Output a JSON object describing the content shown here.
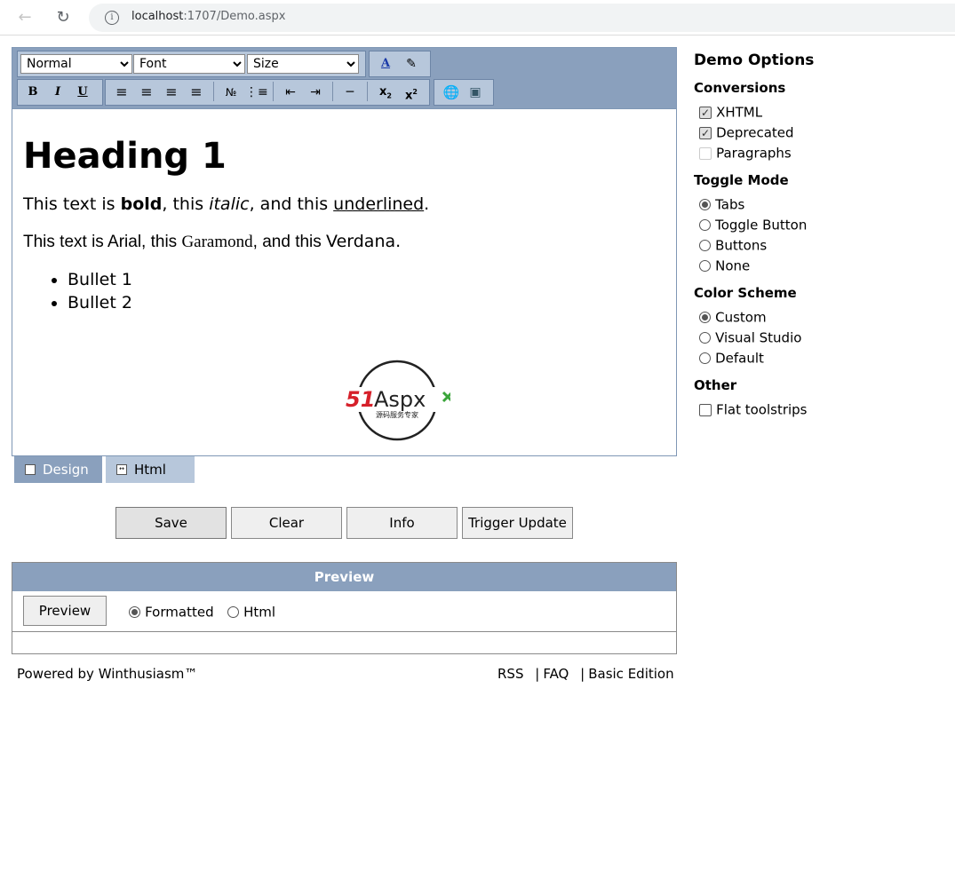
{
  "browser": {
    "url_host": "localhost",
    "url_rest": ":1707/Demo.aspx"
  },
  "toolbar": {
    "paragraph_select": "Normal",
    "font_select": "Font",
    "size_select": "Size"
  },
  "editor_content": {
    "heading": "Heading 1",
    "line1": {
      "a": "This text is ",
      "bold": "bold",
      "b": ", this ",
      "italic": "italic",
      "c": ", and this ",
      "underlined": "underlined",
      "d": "."
    },
    "line2": {
      "a": "This text is Arial, this ",
      "garamond": "Garamond",
      "b": ", and this ",
      "verdana": "Verdana",
      "c": "."
    },
    "bullets": [
      "Bullet 1",
      "Bullet 2"
    ],
    "logo": {
      "text_red": "51",
      "text_dark": "Aspx",
      "subtitle": "源码服务专家"
    }
  },
  "tabs": {
    "design": "Design",
    "html": "Html"
  },
  "buttons": {
    "save": "Save",
    "clear": "Clear",
    "info": "Info",
    "trigger_update": "Trigger Update"
  },
  "preview": {
    "title": "Preview",
    "button": "Preview",
    "options": [
      {
        "label": "Formatted",
        "selected": true
      },
      {
        "label": "Html",
        "selected": false
      }
    ]
  },
  "footer": {
    "powered_by": "Powered by Winthusiasm™",
    "links": [
      "RSS",
      "FAQ",
      "Basic Edition"
    ]
  },
  "demo_options": {
    "title": "Demo Options",
    "conversions": {
      "title": "Conversions",
      "items": [
        {
          "label": "XHTML",
          "checked": true
        },
        {
          "label": "Deprecated",
          "checked": true
        },
        {
          "label": "Paragraphs",
          "checked": false
        }
      ]
    },
    "toggle_mode": {
      "title": "Toggle Mode",
      "items": [
        {
          "label": "Tabs",
          "selected": true
        },
        {
          "label": "Toggle Button",
          "selected": false
        },
        {
          "label": "Buttons",
          "selected": false
        },
        {
          "label": "None",
          "selected": false
        }
      ]
    },
    "color_scheme": {
      "title": "Color Scheme",
      "items": [
        {
          "label": "Custom",
          "selected": true
        },
        {
          "label": "Visual Studio",
          "selected": false
        },
        {
          "label": "Default",
          "selected": false
        }
      ]
    },
    "other": {
      "title": "Other",
      "items": [
        {
          "label": "Flat toolstrips",
          "checked": false
        }
      ]
    }
  },
  "colors": {
    "accent": "#8aa0bd",
    "tab_inactive": "#b7c7db"
  }
}
